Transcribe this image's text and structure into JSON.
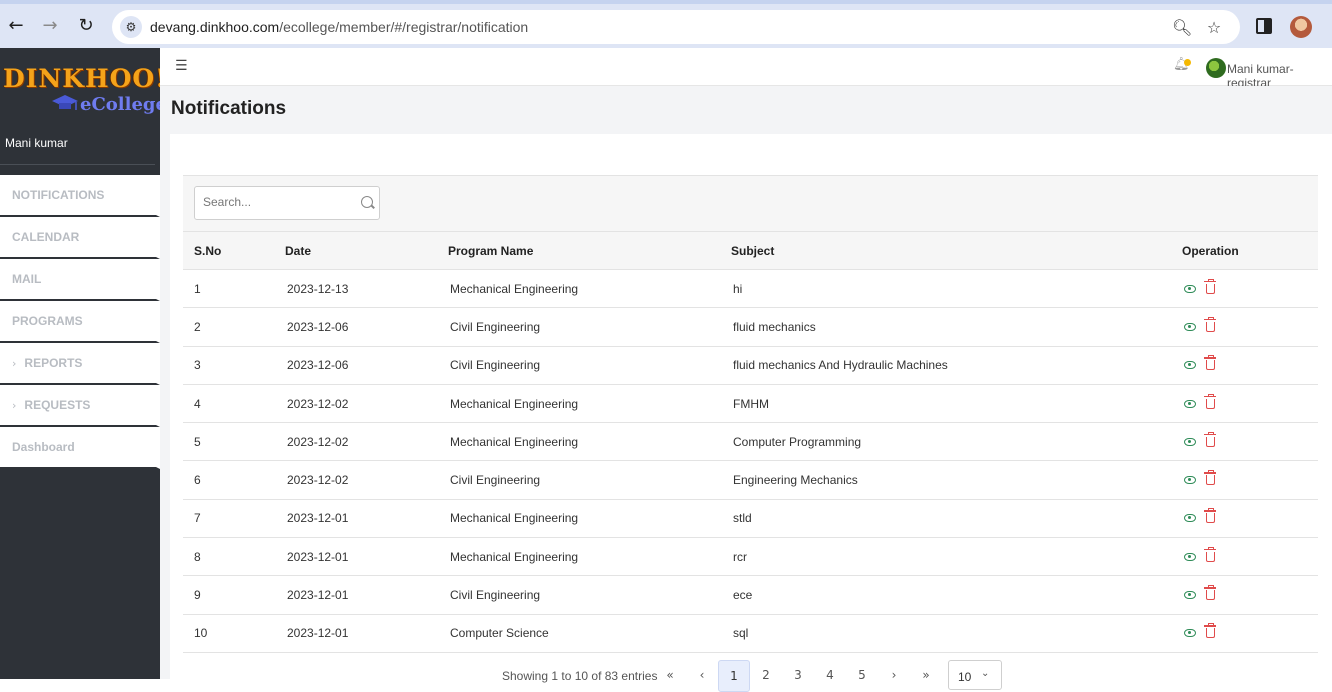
{
  "browser": {
    "url_domain": "devang.dinkhoo.com",
    "url_path": "/ecollege/member/#/registrar/notification"
  },
  "sidebar": {
    "logo_text": "DINKHOO!",
    "logo_sub": "eCollege",
    "user_name": "Mani kumar",
    "items": [
      {
        "label": "NOTIFICATIONS",
        "expandable": false
      },
      {
        "label": "CALENDAR",
        "expandable": false
      },
      {
        "label": "MAIL",
        "expandable": false
      },
      {
        "label": "PROGRAMS",
        "expandable": false
      },
      {
        "label": "REPORTS",
        "expandable": true
      },
      {
        "label": "REQUESTS",
        "expandable": true
      },
      {
        "label": "Dashboard",
        "expandable": false
      }
    ]
  },
  "header": {
    "user_label": "Mani kumar-registrar"
  },
  "page": {
    "title": "Notifications"
  },
  "search": {
    "placeholder": "Search..."
  },
  "table": {
    "columns": [
      "S.No",
      "Date",
      "Program Name",
      "Subject",
      "Operation"
    ],
    "rows": [
      {
        "sno": "1",
        "date": "2023-12-13",
        "program": "Mechanical Engineering",
        "subject": "hi"
      },
      {
        "sno": "2",
        "date": "2023-12-06",
        "program": "Civil Engineering",
        "subject": "fluid mechanics"
      },
      {
        "sno": "3",
        "date": "2023-12-06",
        "program": "Civil Engineering",
        "subject": "fluid mechanics And Hydraulic Machines"
      },
      {
        "sno": "4",
        "date": "2023-12-02",
        "program": "Mechanical Engineering",
        "subject": "FMHM"
      },
      {
        "sno": "5",
        "date": "2023-12-02",
        "program": "Mechanical Engineering",
        "subject": "Computer Programming"
      },
      {
        "sno": "6",
        "date": "2023-12-02",
        "program": "Civil Engineering",
        "subject": "Engineering Mechanics"
      },
      {
        "sno": "7",
        "date": "2023-12-01",
        "program": "Mechanical Engineering",
        "subject": "stld"
      },
      {
        "sno": "8",
        "date": "2023-12-01",
        "program": "Mechanical Engineering",
        "subject": "rcr"
      },
      {
        "sno": "9",
        "date": "2023-12-01",
        "program": "Civil Engineering",
        "subject": "ece"
      },
      {
        "sno": "10",
        "date": "2023-12-01",
        "program": "Computer Science",
        "subject": "sql"
      }
    ]
  },
  "pagination": {
    "info": "Showing 1 to 10 of 83 entries",
    "first": "«",
    "prev": "‹",
    "pages": [
      "1",
      "2",
      "3",
      "4",
      "5"
    ],
    "active_page": "1",
    "next": "›",
    "last": "»",
    "page_size": "10"
  },
  "colors": {
    "sidebar_bg": "#2e3238",
    "view_icon": "#2e8b57",
    "delete_icon": "#e04b4b",
    "notification_dot": "#f5b800"
  }
}
